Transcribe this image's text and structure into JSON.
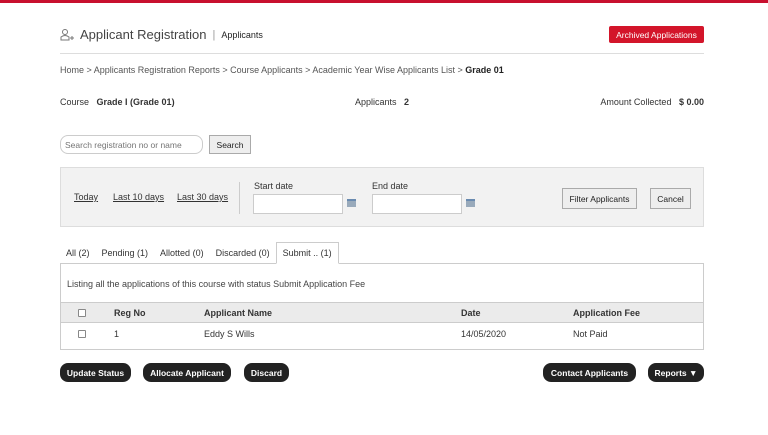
{
  "header": {
    "title": "Applicant Registration",
    "subtitle": "Applicants",
    "archived_label": "Archived Applications"
  },
  "breadcrumb": {
    "items": [
      "Home",
      "Applicants Registration Reports",
      "Course Applicants",
      "Academic Year Wise Applicants List"
    ],
    "current": "Grade 01",
    "separator": ">"
  },
  "summary": {
    "course_label": "Course",
    "course_value": "Grade I (Grade 01)",
    "applicants_label": "Applicants",
    "applicants_value": "2",
    "amount_label": "Amount Collected",
    "amount_value": "$ 0.00"
  },
  "search": {
    "placeholder": "Search registration no or name",
    "button": "Search"
  },
  "filter": {
    "today": "Today",
    "last10": "Last 10 days",
    "last30": "Last 30 days",
    "start_label": "Start date",
    "end_label": "End date",
    "start_value": "",
    "end_value": "",
    "filter_button": "Filter Applicants",
    "cancel_button": "Cancel"
  },
  "tabs": [
    {
      "label": "All (2)"
    },
    {
      "label": "Pending (1)"
    },
    {
      "label": "Allotted (0)"
    },
    {
      "label": "Discarded (0)"
    },
    {
      "label": "Submit .. (1)",
      "active": true
    }
  ],
  "panel": {
    "description": "Listing all the applications of this course with status Submit Application Fee"
  },
  "table": {
    "headers": [
      "Reg No",
      "Applicant Name",
      "Date",
      "Application Fee"
    ],
    "rows": [
      {
        "reg_no": "1",
        "name": "Eddy S Wills",
        "date": "14/05/2020",
        "fee": "Not Paid"
      }
    ]
  },
  "actions": {
    "update": "Update Status",
    "allocate": "Allocate Applicant",
    "discard": "Discard",
    "contact": "Contact Applicants",
    "reports": "Reports ▼"
  },
  "colors": {
    "accent": "#d3152a",
    "dark_button": "#222222"
  }
}
